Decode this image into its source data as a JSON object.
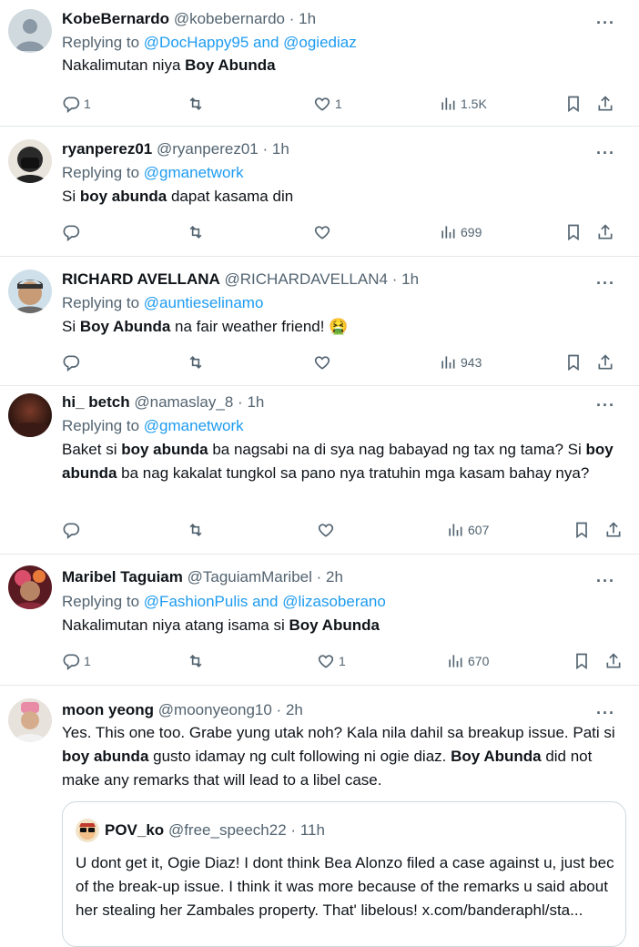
{
  "tweets": [
    {
      "name": "KobeBernardo",
      "handle": "@kobebernardo",
      "time": "1h",
      "replying_prefix": "Replying to",
      "replying_to": "@DocHappy95 and @ogiediaz",
      "text_parts": [
        "Nakalimutan niya ",
        "Boy Abunda",
        ""
      ],
      "replies": "1",
      "retweets": "",
      "likes": "1",
      "views": "1.5K"
    },
    {
      "name": "ryanperez01",
      "handle": "@ryanperez01",
      "time": "1h",
      "replying_prefix": "Replying to",
      "replying_to": "@gmanetwork",
      "text_parts": [
        "Si ",
        "boy abunda",
        " dapat kasama din"
      ],
      "replies": "",
      "retweets": "",
      "likes": "",
      "views": "699"
    },
    {
      "name": "RICHARD AVELLANA",
      "handle": "@RICHARDAVELLAN4",
      "time": "1h",
      "replying_prefix": "Replying to",
      "replying_to": "@auntieselinamo",
      "text_parts": [
        "Si ",
        "Boy Abunda",
        " na fair weather friend! 🤮"
      ],
      "replies": "",
      "retweets": "",
      "likes": "",
      "views": "943"
    },
    {
      "name": "hi_ betch",
      "handle": "@namaslay_8",
      "time": "1h",
      "replying_prefix": "Replying to",
      "replying_to": "@gmanetwork",
      "text_parts": [
        "Baket si ",
        "boy abunda",
        " ba nagsabi na di sya nag babayad ng tax ng tama? Si ",
        "boy abunda",
        " ba nag kakalat tungkol sa pano nya tratuhin mga kasam bahay nya?"
      ],
      "replies": "",
      "retweets": "",
      "likes": "",
      "views": "607"
    },
    {
      "name": "Maribel Taguiam",
      "handle": "@TaguiamMaribel",
      "time": "2h",
      "replying_prefix": "Replying to",
      "replying_to": "@FashionPulis and @lizasoberano",
      "text_parts": [
        "Nakalimutan niya atang isama si ",
        "Boy Abunda",
        ""
      ],
      "replies": "1",
      "retweets": "",
      "likes": "1",
      "views": "670"
    },
    {
      "name": "moon yeong",
      "handle": "@moonyeong10",
      "time": "2h",
      "text_parts": [
        "Yes. This one too. Grabe yung utak noh? Kala nila dahil sa breakup issue. Pati si ",
        "boy abunda",
        " gusto idamay ng cult following ni ogie diaz. ",
        "Boy Abunda",
        " did not make any remarks that will lead to a libel case."
      ]
    }
  ],
  "quote": {
    "name": "POV_ko",
    "handle": "@free_speech22",
    "time": "11h",
    "text": "U dont get it, Ogie Diaz! I dont think Bea Alonzo filed a case against u, just bec of the break-up issue. I think it was more because of the remarks u said about her stealing her Zambales property. That' libelous! x.com/banderaphl/sta..."
  },
  "separator": "·",
  "more_glyph": "···",
  "colors": {
    "mention": "#1d9bf0",
    "secondary": "#536471",
    "divider": "#e4e8eb"
  },
  "icons": [
    "reply-icon",
    "retweet-icon",
    "like-icon",
    "views-icon",
    "bookmark-icon",
    "share-icon",
    "more-icon"
  ]
}
